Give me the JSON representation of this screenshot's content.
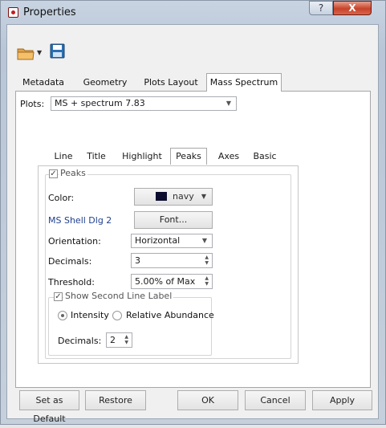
{
  "window": {
    "title": "Properties",
    "help_glyph": "?",
    "close_glyph": "X"
  },
  "toolbar": {
    "open_icon": "folder-icon",
    "save_icon": "save-icon"
  },
  "tabs": [
    {
      "label": "Metadata",
      "active": false
    },
    {
      "label": "Geometry",
      "active": false
    },
    {
      "label": "Plots Layout",
      "active": false
    },
    {
      "label": "Mass Spectrum",
      "active": true
    }
  ],
  "plots": {
    "label": "Plots:",
    "value": "MS + spectrum 7.83"
  },
  "subtabs": [
    {
      "label": "Line",
      "active": false
    },
    {
      "label": "Title",
      "active": false
    },
    {
      "label": "Highlight",
      "active": false
    },
    {
      "label": "Peaks",
      "active": true
    },
    {
      "label": "Axes",
      "active": false
    },
    {
      "label": "Basic",
      "active": false
    }
  ],
  "peaks": {
    "checkbox_label": "Peaks",
    "checked": true,
    "color_label": "Color:",
    "color_value": "navy",
    "color_hex": "#0c0c2e",
    "font_name": "MS Shell Dlg 2",
    "font_button": "Font...",
    "orientation_label": "Orientation:",
    "orientation_value": "Horizontal",
    "decimals_label": "Decimals:",
    "decimals_value": "3",
    "threshold_label": "Threshold:",
    "threshold_value": "5.00% of Max"
  },
  "second_line": {
    "checkbox_label": "Show Second Line Label",
    "checked": true,
    "radio_intensity": "Intensity",
    "radio_relative": "Relative Abundance",
    "selected": "Intensity",
    "decimals_label": "Decimals:",
    "decimals_value": "2"
  },
  "footer": {
    "set_default": "Set as Default",
    "restore": "Restore",
    "ok": "OK",
    "cancel": "Cancel",
    "apply": "Apply"
  },
  "colors": {
    "accent_link": "#1f3f8f",
    "title_gradient": "#c9d4e2"
  }
}
